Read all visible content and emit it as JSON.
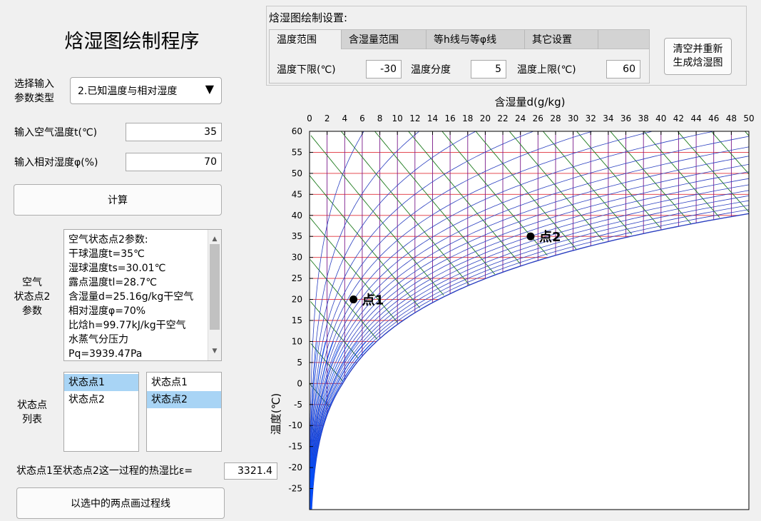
{
  "app": {
    "title": "焓湿图绘制程序"
  },
  "inputs": {
    "param_type_label": "选择输入\n参数类型",
    "param_type_value": "2.已知温度与相对湿度",
    "temp_label": "输入空气温度t(℃)",
    "temp_value": "35",
    "rh_label": "输入相对湿度φ(%)",
    "rh_value": "70",
    "calc_button": "计算"
  },
  "state_info": {
    "label": "空气\n状态点2\n参数",
    "lines": [
      "空气状态点2参数:",
      "干球温度t=35℃",
      "湿球温度ts=30.01℃",
      "露点温度tl=28.7℃",
      "含湿量d=25.16g/kg干空气",
      "相对湿度φ=70%",
      "比焓h=99.77kJ/kg干空气",
      "水蒸气分压力",
      "Pq=3939.47Pa"
    ]
  },
  "state_list": {
    "label": "状态点\n列表",
    "list1": [
      {
        "text": "状态点1",
        "selected": true
      },
      {
        "text": "状态点2",
        "selected": false
      }
    ],
    "list2": [
      {
        "text": "状态点1",
        "selected": false
      },
      {
        "text": "状态点2",
        "selected": true
      }
    ]
  },
  "ratio": {
    "label": "状态点1至状态点2这一过程的热湿比ε=",
    "value": "3321.4"
  },
  "draw_process_button": "以选中的两点画过程线",
  "settings": {
    "title": "焓湿图绘制设置:",
    "tabs": [
      "温度范围",
      "含湿量范围",
      "等h线与等φ线",
      "其它设置"
    ],
    "active_tab": 0,
    "temp_min_label": "温度下限(℃)",
    "temp_min_value": "-30",
    "temp_step_label": "温度分度",
    "temp_step_value": "5",
    "temp_max_label": "温度上限(℃)",
    "temp_max_value": "60",
    "regenerate_button": "清空并重新\n生成焓湿图"
  },
  "chart_data": {
    "type": "scatter",
    "xlabel": "含湿量d(g/kg)",
    "ylabel": "温度(℃)",
    "xlim": [
      0,
      50
    ],
    "ylim": [
      -30,
      60
    ],
    "xticks": [
      0,
      2,
      4,
      6,
      8,
      10,
      12,
      14,
      16,
      18,
      20,
      22,
      24,
      26,
      28,
      30,
      32,
      34,
      36,
      38,
      40,
      42,
      44,
      46,
      48,
      50
    ],
    "yticks": [
      60,
      55,
      50,
      45,
      40,
      35,
      30,
      25,
      20,
      15,
      10,
      5,
      0,
      -5,
      -10,
      -15,
      -20,
      -25
    ],
    "x_axis_position": "top",
    "grid": false,
    "points": [
      {
        "name": "点1",
        "d": 5.0,
        "t": 20
      },
      {
        "name": "点2",
        "d": 25.16,
        "t": 35
      }
    ],
    "line_colors": {
      "isotherm": "#e0303a",
      "moisture": "#7a1a8a",
      "enthalpy": "#1d7a1d",
      "rh": "#2a3fc0",
      "rh_low": "#0050ff"
    }
  }
}
